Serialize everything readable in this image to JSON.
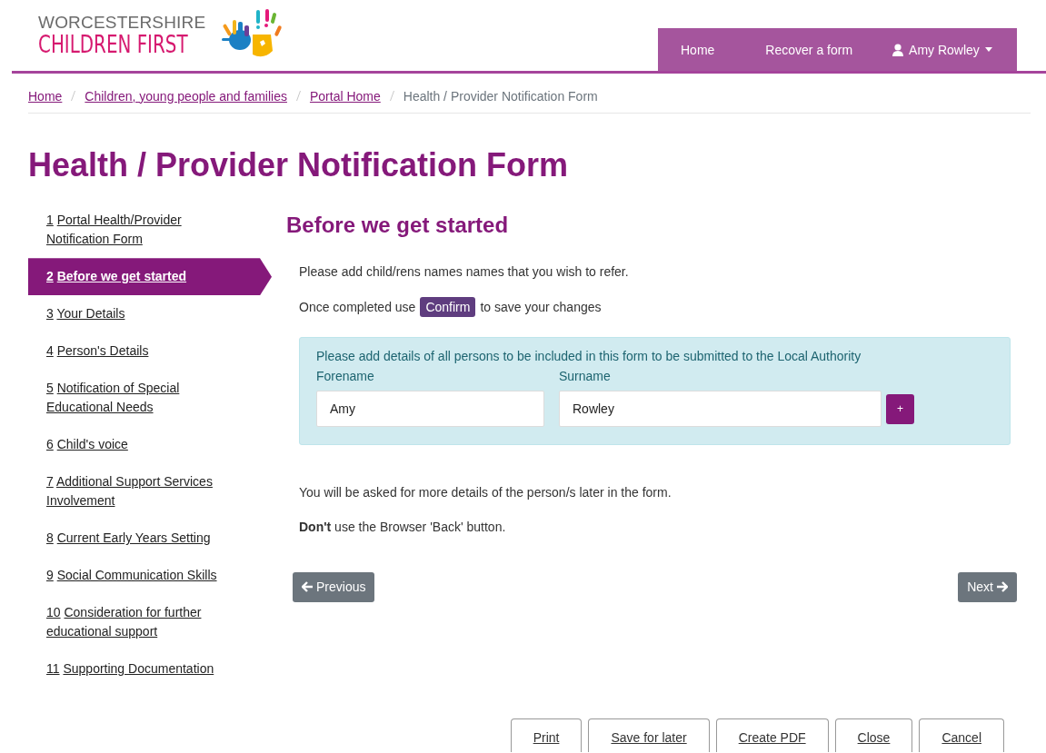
{
  "logo": {
    "line_1": "WORCESTERSHIRE",
    "line_2": "CHILDREN FIRST"
  },
  "nav": {
    "items": [
      {
        "label": "Home",
        "kind": "link"
      },
      {
        "label": "Recover a form",
        "kind": "link"
      },
      {
        "label": "Amy Rowley",
        "kind": "user"
      }
    ]
  },
  "breadcrumb": [
    {
      "label": "Home",
      "kind": "link"
    },
    {
      "label": "Children, young people and families",
      "kind": "link"
    },
    {
      "label": "Portal Home",
      "kind": "link"
    },
    {
      "label": "Health / Provider Notification Form",
      "kind": "current"
    }
  ],
  "page_title": "Health / Provider Notification Form",
  "steps": [
    {
      "number": "1",
      "label": "Portal Health/Provider Notification Form",
      "selected": false
    },
    {
      "number": "2",
      "label": "Before we get started",
      "selected": true
    },
    {
      "number": "3",
      "label": "Your Details",
      "selected": false
    },
    {
      "number": "4",
      "label": "Person's Details",
      "selected": false
    },
    {
      "number": "5",
      "label": "Notification of Special Educational Needs",
      "selected": false
    },
    {
      "number": "6",
      "label": "Child's voice",
      "selected": false
    },
    {
      "number": "7",
      "label": "Additional Support Services Involvement",
      "selected": false
    },
    {
      "number": "8",
      "label": "Current Early Years Setting",
      "selected": false
    },
    {
      "number": "9",
      "label": "Social Communication Skills",
      "selected": false
    },
    {
      "number": "10",
      "label": "Consideration for further educational support",
      "selected": false
    },
    {
      "number": "11",
      "label": "Supporting Documentation",
      "selected": false
    }
  ],
  "section": {
    "heading": "Before we get started",
    "intro": "Please add child/rens names names that you wish to refer.",
    "confirm_note": {
      "before": "Once completed use",
      "badge": "Confirm",
      "after": "to save your changes"
    },
    "persons_box": {
      "note": "Please add details of all persons to be included in this form to be submitted to the Local Authority",
      "fields": [
        {
          "label": "Forename",
          "value": "Amy"
        },
        {
          "label": "Surname",
          "value": "Rowley"
        }
      ],
      "add_button": "+"
    },
    "later_note": "You will be asked for more details of the person/s later in the form.",
    "warning": "**Don't** use the Browser 'Back' button."
  },
  "pager": {
    "previous": "Previous",
    "next": "Next"
  },
  "footer_buttons": [
    "Print",
    "Save for later",
    "Create PDF",
    "Close",
    "Cancel"
  ]
}
